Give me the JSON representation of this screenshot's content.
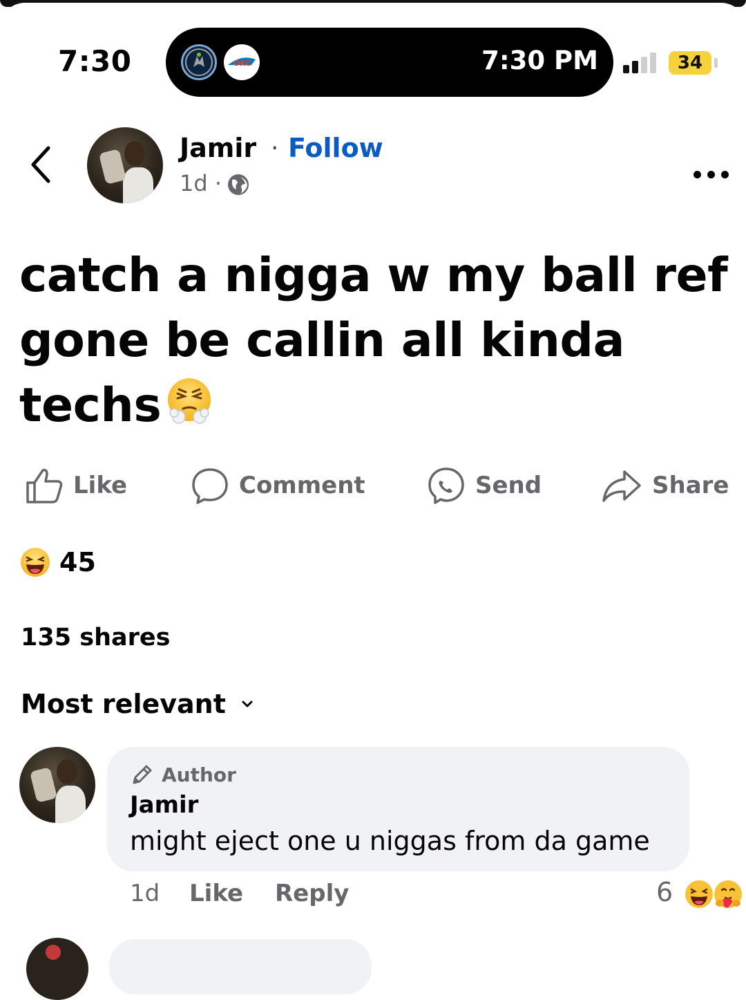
{
  "status_bar": {
    "time": "7:30",
    "live_activity_time": "7:30 PM",
    "battery": "34"
  },
  "post": {
    "author": "Jamir",
    "separator": "·",
    "follow_label": "Follow",
    "age": "1d ·",
    "text_line1": "catch a nigga w my ball ref",
    "text_line2": "gone be callin all kinda",
    "text_line3": "techs",
    "actions": {
      "like": "Like",
      "comment": "Comment",
      "send": "Send",
      "share": "Share"
    },
    "reaction_count": "45",
    "shares": "135 shares"
  },
  "comments": {
    "sort_label": "Most relevant",
    "items": [
      {
        "badge": "Author",
        "name": "Jamir",
        "text": "might eject one u niggas from da game",
        "age": "1d",
        "like_label": "Like",
        "reply_label": "Reply",
        "reaction_count": "6"
      }
    ]
  },
  "colors": {
    "follow": "#0a5cc4",
    "secondary_text": "#65676b",
    "bubble": "#f0f2f5",
    "battery": "#f5d23c"
  },
  "icons": [
    "back-chevron-icon",
    "globe-icon",
    "more-dots-icon",
    "like-thumb-icon",
    "comment-bubble-icon",
    "messenger-send-icon",
    "share-arrow-icon",
    "laugh-emoji-icon",
    "huffing-emoji-icon",
    "pencil-icon",
    "chevron-down-icon",
    "signal-icon",
    "battery-icon"
  ]
}
